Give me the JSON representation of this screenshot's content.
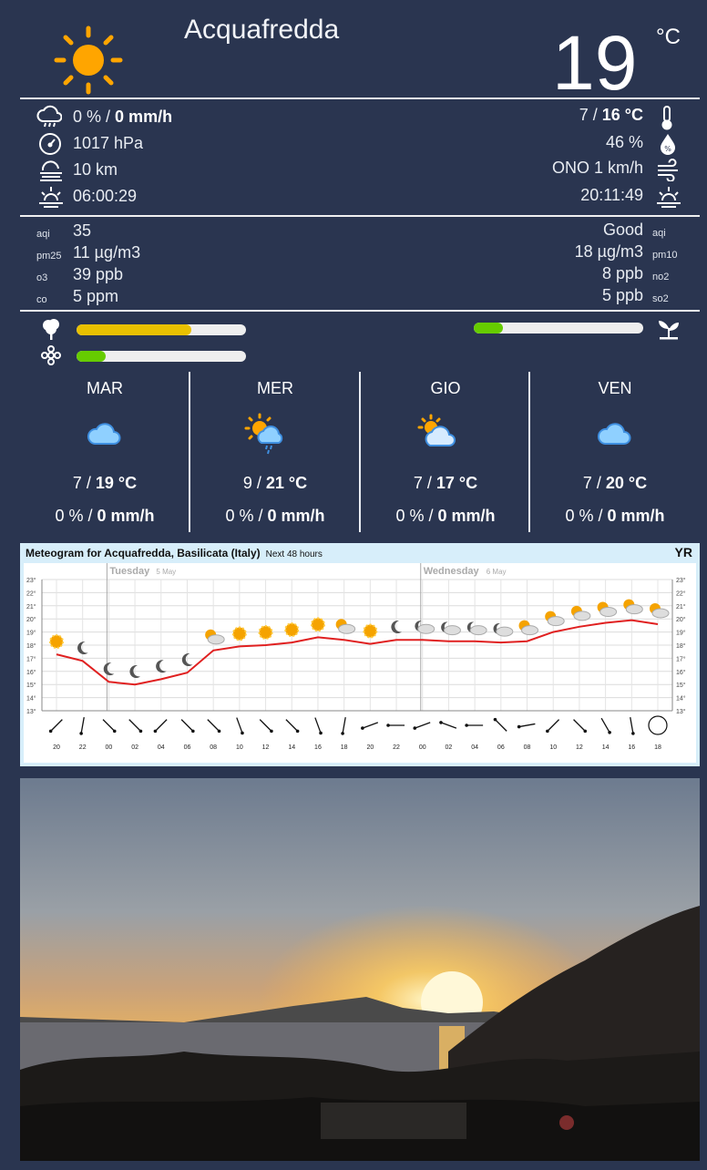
{
  "current": {
    "city": "Acquafredda",
    "temp": "19",
    "unit": "°C",
    "icon": "sun-icon"
  },
  "details": {
    "rain_pct": "0 %",
    "rain_sep": " / ",
    "rain_rate": "0 mm/h",
    "pressure": "1017 hPa",
    "visibility": "10 km",
    "sunrise": "06:00:29",
    "temp_min": "7",
    "temp_max": "16 °C",
    "humidity": "46 %",
    "wind": "ONO 1 km/h",
    "sunset": "20:11:49"
  },
  "air": {
    "aqi_label": "aqi",
    "aqi_value": "35",
    "quality_text": "Good",
    "quality_label": "aqi",
    "pm25_label": "pm25",
    "pm25_value": "11 µg/m3",
    "pm10_value": "18 µg/m3",
    "pm10_label": "pm10",
    "o3_label": "o3",
    "o3_value": "39 ppb",
    "no2_value": "8 ppb",
    "no2_label": "no2",
    "co_label": "co",
    "co_value": "5 ppm",
    "so2_value": "5 ppb",
    "so2_label": "so2"
  },
  "pollen": {
    "tree_level": 0.68,
    "flower_level": 0.17,
    "grass_level": 0.17,
    "tree_color": "#e8c000",
    "low_color": "#66cc00"
  },
  "forecast": [
    {
      "day": "MAR",
      "min": "7",
      "max": "19 °C",
      "rain_pct": "0 %",
      "rain": "0 mm/h",
      "icon": "cloud-icon"
    },
    {
      "day": "MER",
      "min": "9",
      "max": "21 °C",
      "rain_pct": "0 %",
      "rain": "0 mm/h",
      "icon": "sun-cloud-rain-icon"
    },
    {
      "day": "GIO",
      "min": "7",
      "max": "17 °C",
      "rain_pct": "0 %",
      "rain": "0 mm/h",
      "icon": "sun-cloud-icon"
    },
    {
      "day": "VEN",
      "min": "7",
      "max": "20 °C",
      "rain_pct": "0 %",
      "rain": "0 mm/h",
      "icon": "cloud-icon"
    }
  ],
  "meteogram": {
    "title": "Meteogram for Acquafredda, Basilicata (Italy)",
    "subtitle": "Next 48 hours",
    "logo": "YR",
    "day1": "Tuesday",
    "day1_date": "5 May",
    "day2": "Wednesday",
    "day2_date": "6 May"
  },
  "chart_data": {
    "type": "line",
    "x": [
      "20",
      "22",
      "00",
      "02",
      "04",
      "06",
      "08",
      "10",
      "12",
      "14",
      "16",
      "18",
      "20",
      "22",
      "00",
      "02",
      "04",
      "06",
      "08",
      "10",
      "12",
      "14",
      "16",
      "18"
    ],
    "y_ticks": [
      "23°",
      "22°",
      "21°",
      "20°",
      "19°",
      "18°",
      "17°",
      "16°",
      "15°",
      "14°",
      "13°"
    ],
    "ylim": [
      13,
      23
    ],
    "series": [
      {
        "values": [
          17.3,
          16.8,
          15.2,
          15.0,
          15.4,
          15.9,
          17.6,
          17.9,
          18.0,
          18.2,
          18.6,
          18.4,
          18.1,
          18.4,
          18.4,
          18.3,
          18.3,
          18.2,
          18.3,
          19.0,
          19.4,
          19.7,
          19.9,
          19.6
        ]
      }
    ],
    "weather_symbols": [
      "sun",
      "moon",
      "moon",
      "moon",
      "moon",
      "moon",
      "sun-cloud",
      "sun",
      "sun",
      "sun",
      "sun",
      "sun-cloud",
      "sun",
      "moon",
      "moon-cloud",
      "moon-cloud",
      "moon-cloud",
      "moon-cloud",
      "sun-cloud",
      "sun-cloud",
      "sun-cloud",
      "sun-cloud",
      "sun-cloud",
      "sun-cloud"
    ],
    "wind_directions_deg": [
      135,
      100,
      45,
      45,
      135,
      45,
      45,
      70,
      45,
      45,
      70,
      100,
      160,
      180,
      160,
      200,
      180,
      225,
      170,
      135,
      45,
      60,
      80,
      0
    ],
    "line_color": "#e02020"
  },
  "webcam": {
    "alt": "sunset-webcam"
  }
}
